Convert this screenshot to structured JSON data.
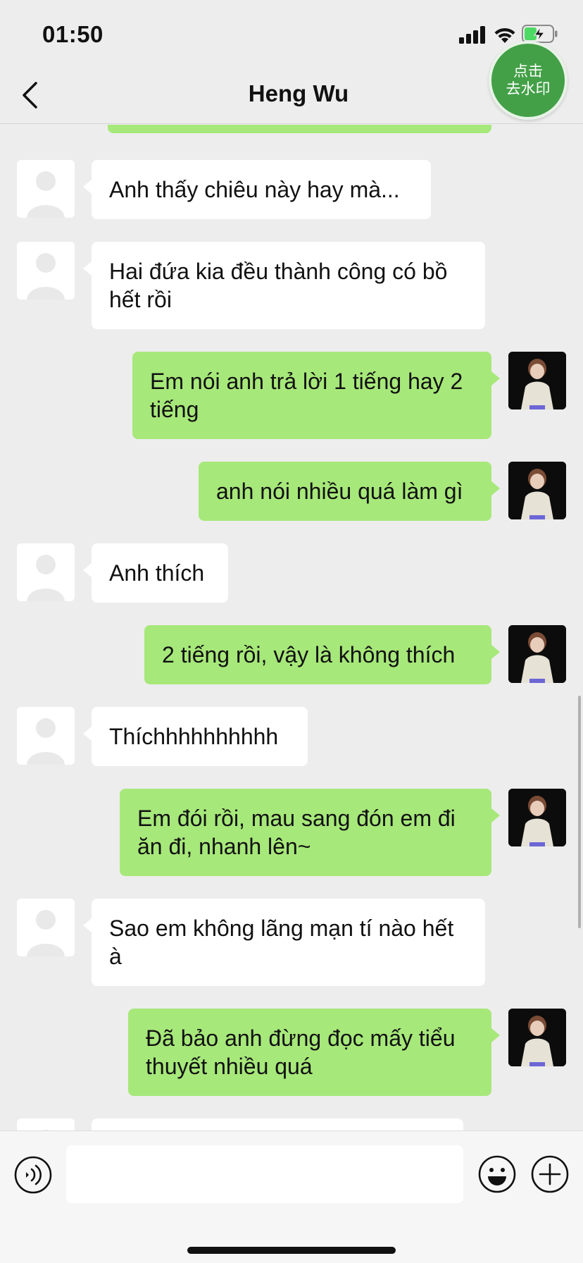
{
  "status_bar": {
    "time": "01:50"
  },
  "header": {
    "title": "Heng Wu",
    "watermark_line1": "点击",
    "watermark_line2": "去水印"
  },
  "messages": [
    {
      "side": "out",
      "text": ""
    },
    {
      "side": "in",
      "text": "Anh thấy chiêu này hay mà..."
    },
    {
      "side": "in",
      "text": "Hai đứa kia đều thành công có bồ hết rồi"
    },
    {
      "side": "out",
      "text": "Em nói anh trả lời 1 tiếng hay 2 tiếng"
    },
    {
      "side": "out",
      "text": "anh nói nhiều quá làm gì"
    },
    {
      "side": "in",
      "text": "Anh thích"
    },
    {
      "side": "out",
      "text": "2 tiếng rồi, vậy là không thích"
    },
    {
      "side": "in",
      "text": "Thíchhhhhhhhhh"
    },
    {
      "side": "out",
      "text": "Em đói rồi, mau sang đón em đi ăn đi, nhanh lên~"
    },
    {
      "side": "in",
      "text": "Sao em không lãng mạn tí nào hết à"
    },
    {
      "side": "out",
      "text": "Đã bảo anh đừng đọc mấy tiểu thuyết nhiều quá"
    },
    {
      "side": "in",
      "text": ""
    }
  ],
  "input": {
    "value": ""
  },
  "colors": {
    "bubble_out": "#a7e87a",
    "bubble_in": "#ffffff",
    "background": "#ededed",
    "watermark_button": "#43a047"
  }
}
